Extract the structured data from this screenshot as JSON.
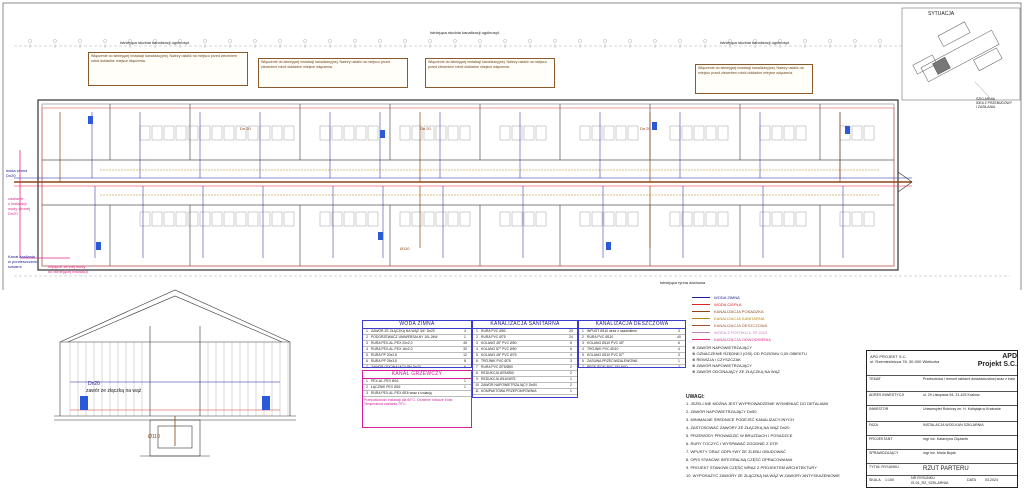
{
  "situation": {
    "title": "SYTUACJA",
    "caption": "SZKLARNIA\nIDEA Z PRZEBUDOWY\nI ZASILANIA"
  },
  "plan": {
    "labels": {
      "main_row": "Dn 20",
      "left_tag": "woda zimna\nDn20",
      "left_pink": "zasilanie\nz instalacji\nwody zimnej\nDn20",
      "bottom_left": "Kanał zasilania\nw pomieszczeniu\nszklarni",
      "bottom_pink": "Wpięcie zimnej wody\ndo istniejącej instalacji",
      "gutter_caption": "Istniejąca rynna dachowa",
      "pipe_tag": "Ø110"
    },
    "notes": [
      "Włączenie do istniejącej instalacji kanalizacyjnej. Należy ustalić na miejscu przed zleceniem robót dokładne miejsce włączenia.",
      "Włączenie do istniejącej instalacji kanalizacyjnej. Należy ustalić na miejscu przed zleceniem robót dokładne miejsce włączenia.",
      "Włączenie do istniejącej instalacji kanalizacyjnej. Należy ustalić na miejscu przed zleceniem robót dokładne miejsce włączenia.",
      "Włączenie do istniejącej instalacji kanalizacyjnej. Należy ustalić na miejscu przed zleceniem robót dokładne miejsce włączenia."
    ],
    "top_caption": "Istniejąca studnia kanalizacji ogólnospł."
  },
  "section": {
    "labels": {
      "dn": "Dn20",
      "valve": "zawór ze złączką na wąż",
      "dim": "Ø110"
    }
  },
  "tables": {
    "water": {
      "title": "WODA ZIMNA",
      "rows": [
        [
          "1",
          "ZAWÓR ZE ZŁĄCZKĄ NA WĄŻ 3/4\" Dn20",
          "4"
        ],
        [
          "2",
          "PODGRZEWACZ UNIWERSALNY 10L 2kW",
          "1"
        ],
        [
          "3",
          "RURA PEX-AL-PEX 20x2,0",
          "45"
        ],
        [
          "4",
          "RURA PEX-AL-PEX 16x2,0",
          "30"
        ],
        [
          "5",
          "RURA PP 20x2,8",
          "12"
        ],
        [
          "6",
          "RURA PP 25x3,5",
          "8"
        ],
        [
          "7",
          "ZAWÓR ODCINAJĄCY PN Dn20",
          "6"
        ]
      ]
    },
    "drain": {
      "title": "KANALIZACJA SANITARNA",
      "rows": [
        [
          "1",
          "RURA PVC Ø50",
          "20"
        ],
        [
          "2",
          "RURA PVC Ø75",
          "24"
        ],
        [
          "3",
          "KOLANO 45° PVC Ø50",
          "8"
        ],
        [
          "4",
          "KOLANO 87° PVC Ø50",
          "6"
        ],
        [
          "5",
          "KOLANO 45° PVC Ø75",
          "4"
        ],
        [
          "6",
          "TRÓJNIK PVC Ø75",
          "3"
        ],
        [
          "7",
          "RURA PVC Ø75/Ø50",
          "2"
        ],
        [
          "8",
          "REDUKCJA Ø75/Ø50",
          "2"
        ],
        [
          "9",
          "REDUKCJA Ø110/Ø75",
          "1"
        ],
        [
          "10",
          "ZAWÓR NAPOWIETRZAJĄCY Dn50",
          "2"
        ],
        [
          "11",
          "KOMPAKTOWA PRZEPOMPOWNIA",
          "1"
        ]
      ]
    },
    "rain": {
      "title": "KANALIZACJA DESZCZOWA",
      "rows": [
        [
          "1",
          "WPUST Ø110 wraz z osadnikiem",
          "3"
        ],
        [
          "2",
          "RURA PVC Ø110",
          "40"
        ],
        [
          "3",
          "KOLANO Ø110 PVC 45°",
          "6"
        ],
        [
          "4",
          "TRÓJNIK PVC Ø110",
          "4"
        ],
        [
          "5",
          "KOLANO Ø110 PVC 87°",
          "3"
        ],
        [
          "6",
          "ZASUWA PRZECIWZALEWOWA",
          "1"
        ],
        [
          "7",
          "PRZEJŚCIE PVC ŻELIWO",
          "2"
        ]
      ]
    },
    "heating": {
      "title": "KANAŁ GRZEWCZY",
      "rows": [
        [
          "1",
          "PEX-AL-PEX Ø16",
          "1"
        ],
        [
          "2",
          "ŁĄCZNIK PEX Ø16",
          "1"
        ],
        [
          "3",
          "RURA PEX-AL-PEX Ø16 wraz z izolacją"
        ]
      ],
      "note": "Przepustowość instalacji dla 60°C. Ciśnienie robocze 6 bar. Temperatura zasilania 70°C."
    }
  },
  "legend": {
    "items": [
      {
        "label": "WODA ZIMNA",
        "color": "#1a1a9a"
      },
      {
        "label": "WODA CIEPŁA",
        "color": "#e0202a"
      },
      {
        "label": "KANALIZACJA POSADZKA",
        "color": "#8b4513"
      },
      {
        "label": "KANALIZACJA SANITARNA",
        "color": "#b8860b"
      },
      {
        "label": "KANALIZACJA DESZCZOWA",
        "color": "#a0522d"
      },
      {
        "label": "WODA Z POTOKU Ł. IR 2013",
        "color": "#c080c0"
      },
      {
        "label": "KANALIZACJA ODWODNIENIA",
        "color": "#dd2a8a"
      }
    ],
    "symbols": [
      "ZAWÓR NAPOWIETRZAJĄCY",
      "OZNACZENIE RZĘDNEJ (OSI) OD POZIOMU 0,00 OBIEKTU",
      "REWIZJA / CZYSZCZAK",
      "ZAWÓR NAPOWIETRZAJĄCY",
      "ZAWÓR ODCINAJĄCY ZE ZŁĄCZKĄ NA WĄŻ"
    ],
    "notes_title": "UWAGI:",
    "notes": [
      "1. JEŻELI NIE MOŻNA JEST WYPROWADZENIE WYMIENIAĆ DO DETALIAMI",
      "2. ZAWÓR NAPOWIETRZAJĄCY Dn50",
      "3. MINIMALNE ŚREDNICE PODEJŚĆ KANALIZACYJNYCH",
      "4. ZASTOSOWAĆ ZAWORY ZE ZŁĄCZKĄ NA WĄŻ Dn20",
      "5. PRZEWODY PROWADZIĆ W BRUZDACH I POSADZCE",
      "6. RURY TOCZYĆ I WYSPAWAĆ ZGODNIE Z DTR",
      "7. WPUSTY ORAZ ODPŁYWY ZE ŻLEBU OBUDOWAĆ",
      "8. OPIS STANOWI INTEGRALNĄ CZĘŚĆ OPRACOWANIA",
      "9. PROJEKT STANOWI CZĘŚĆ WRAZ Z PROJEKTEM ARCHITEKTURY",
      "10. WYPOSAŻYĆ ZAWORY ZE ZŁĄCZKĄ NA WĄŻ W ZAWORY ANTYSKAŻENIOWE"
    ]
  },
  "titleblock": {
    "company": "APD PROJEKT S.C.",
    "company_addr": "ul. Rzemieślnicza 78, 30-000 Wieliczka",
    "logo_text": "APD\nProjekt S.C.",
    "rows": [
      {
        "k": "TEMAT",
        "v": "Przebudowa i remont szklarni doświadczalnej wraz z instalacjami"
      },
      {
        "k": "ADRES INWESTYCJI",
        "v": "ul. 29 Listopada 54, 31-425 Kraków"
      },
      {
        "k": "INWESTOR",
        "v": "Uniwersytet Rolniczy im. H. Kołłątaja w Krakowie"
      },
      {
        "k": "FAZA",
        "v": "INSTALACJA WOD-KAN SZKLARNIA"
      },
      {
        "k": "PROJEKTANT",
        "v": "mgr inż. Katarzyna Ciężarek"
      },
      {
        "k": "SPRAWDZAJĄCY",
        "v": "mgr inż. Maria Bujak"
      },
      {
        "k": "TYTUŁ RYSUNKU",
        "v": "RZUT PARTERU"
      }
    ],
    "scale_label": "SKALA",
    "scale": "1:100",
    "number_label": "NR RYSUNKU",
    "number": "IS-01_RZ_SZKLARNIA",
    "date_label": "DATA",
    "date": "03.2024"
  }
}
